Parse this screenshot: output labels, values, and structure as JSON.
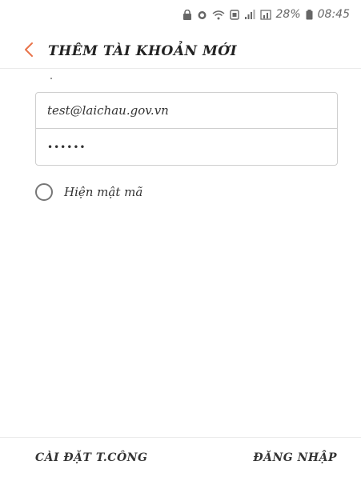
{
  "status_bar": {
    "battery_percent": "28%",
    "time": "08:45",
    "icons": [
      "lock-icon",
      "alarm-icon",
      "wifi-icon",
      "nfc-icon",
      "signal-icon",
      "signal-box-icon",
      "battery-icon"
    ]
  },
  "header": {
    "back_icon": "chevron-left-icon",
    "title": "THÊM TÀI KHOẢN MỚI"
  },
  "form": {
    "email_value": "test@laichau.gov.vn",
    "password_value": "••••••"
  },
  "show_password": {
    "label": "Hiện mật mã",
    "checked": false
  },
  "footer": {
    "manual_setup_label": "CÀI ĐẶT T.CÔNG",
    "login_label": "ĐĂNG NHẬP"
  },
  "colors": {
    "accent": "#e8734a",
    "border": "#cfcfcf"
  }
}
